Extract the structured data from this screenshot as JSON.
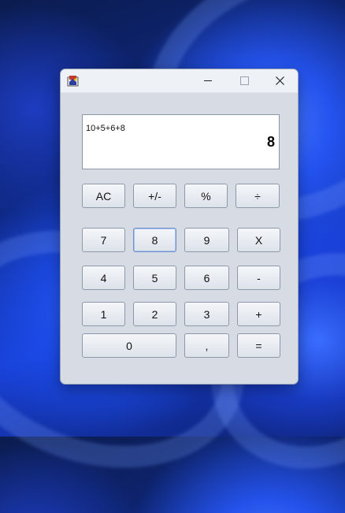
{
  "window": {
    "title": "",
    "minimize_glyph": "—",
    "maximize_glyph": "☐",
    "close_glyph": "✕"
  },
  "display": {
    "expression": "10+5+6+8",
    "result": "8"
  },
  "keys": {
    "row1": [
      "AC",
      "+/-",
      "%",
      "÷"
    ],
    "row2": [
      "7",
      "8",
      "9",
      "X"
    ],
    "row3": [
      "4",
      "5",
      "6",
      "-"
    ],
    "row4": [
      "1",
      "2",
      "3",
      "+"
    ],
    "row5": [
      "0",
      ",",
      "="
    ]
  },
  "colors": {
    "window_bg": "#d6dbe4",
    "titlebar_bg": "#eef1f6",
    "display_bg": "#ffffff",
    "focus_border": "#6e8fc9"
  }
}
